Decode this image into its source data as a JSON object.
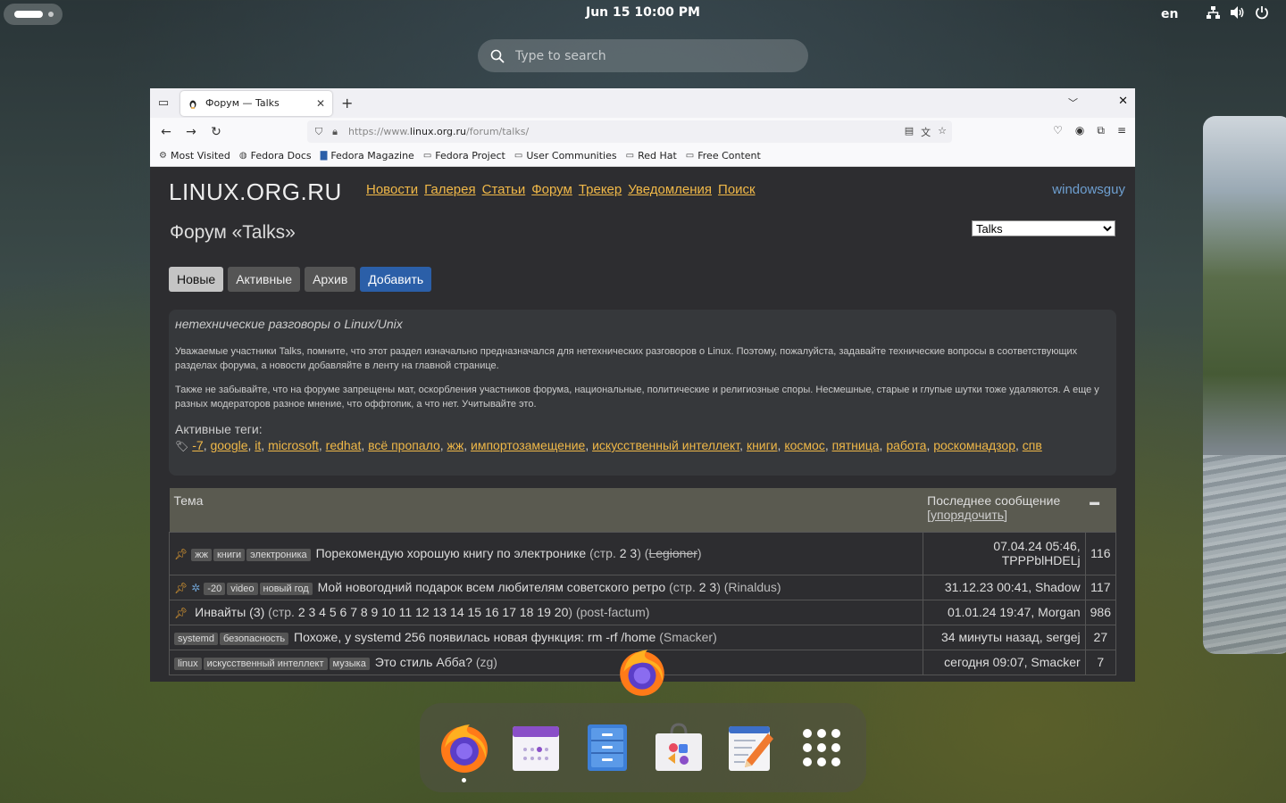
{
  "topbar": {
    "clock": "Jun 15  10:00 PM",
    "lang": "en",
    "tray_icons": [
      "network-icon",
      "volume-icon",
      "power-icon"
    ]
  },
  "search": {
    "placeholder": "Type to search"
  },
  "browser": {
    "tab_title": "Форум — Talks",
    "url_prefix": "https://www.",
    "url_domain": "linux.org.ru",
    "url_path": "/forum/talks/",
    "bookmarks": [
      "Most Visited",
      "Fedora Docs",
      "Fedora Magazine",
      "Fedora Project",
      "User Communities",
      "Red Hat",
      "Free Content"
    ]
  },
  "site": {
    "logo": "LINUX.ORG.RU",
    "nav": [
      "Новости",
      "Галерея",
      "Статьи",
      "Форум",
      "Трекер",
      "Уведомления",
      "Поиск"
    ],
    "user": "windowsguy",
    "forum_title": "Форум «Talks»",
    "select_value": "Talks",
    "buttons": [
      "Новые",
      "Активные",
      "Архив",
      "Добавить"
    ],
    "info_lead": "нетехнические разговоры о Linux/Unix",
    "info_p1": "Уважаемые участники Talks, помните, что этот раздел изначально предназначался для нетехнических разговоров о Linux. Поэтому, пожалуйста, задавайте технические вопросы в соответствующих разделах форума, а новости добавляйте в ленту на главной странице.",
    "info_p2": "Также не забывайте, что на форуме запрещены мат, оскорбления участников форума, национальные, политические и религиозные споры. Несмешные, старые и глупые шутки тоже удаляются. А еще у разных модераторов разное мнение, что оффтопик, а что нет. Учитывайте это.",
    "active_tags_label": "Активные теги:",
    "active_tags": [
      "-7",
      "google",
      "it",
      "microsoft",
      "redhat",
      "всё пропало",
      "жж",
      "импортозамещение",
      "искусственный интеллект",
      "книги",
      "космос",
      "пятница",
      "работа",
      "роскомнадзор",
      "спв"
    ],
    "table": {
      "col_topic": "Тема",
      "col_last": "Последнее сообщение",
      "col_sort": "[упорядочить]",
      "rows": [
        {
          "tags": [
            "жж",
            "книги",
            "электроника"
          ],
          "title": "Порекомендую хорошую книгу по электронике",
          "pages_prefix": "(стр.",
          "pages": "2 3",
          "author": "Legioner",
          "last": "07.04.24 05:46, TPPPblHDELj",
          "count": "116"
        },
        {
          "tags": [
            "-20",
            "video",
            "новый год"
          ],
          "title": "Мой новогодний подарок всем любителям советского ретро",
          "pages_prefix": "(стр.",
          "pages": "2 3",
          "author": "(Rinaldus)",
          "last": "31.12.23 00:41, Shadow",
          "count": "117"
        },
        {
          "tags": [],
          "title": "Инвайты (3)",
          "pages_prefix": "(стр.",
          "pages": "2 3 4 5 6 7 8 9 10 11 12 13 14 15 16 17 18 19 20",
          "author": "(post-factum)",
          "last": "01.01.24 19:47, Morgan",
          "count": "986"
        },
        {
          "tags": [
            "systemd",
            "безопасность"
          ],
          "title": "Похоже, у systemd 256 появилась новая функция: rm -rf /home",
          "author": "(Smacker)",
          "last": "34 минуты назад, sergej",
          "count": "27"
        },
        {
          "tags": [
            "linux",
            "искусственный интеллект",
            "музыка"
          ],
          "title": "Это стиль Абба?",
          "author": "(zg)",
          "last": "сегодня 09:07, Smacker",
          "count": "7"
        }
      ]
    }
  },
  "dock": [
    "firefox-icon",
    "calendar-icon",
    "files-icon",
    "software-icon",
    "text-editor-icon",
    "app-grid-icon"
  ],
  "colors": {
    "accent_link": "#f0b848",
    "user_link": "#6e9fd0",
    "primary_button": "#2b5fa8"
  }
}
